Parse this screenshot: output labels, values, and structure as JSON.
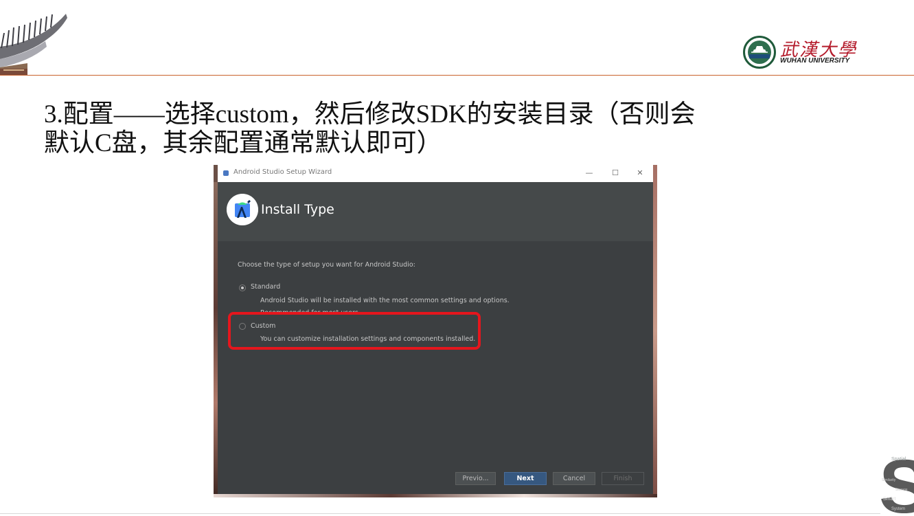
{
  "slide": {
    "title_line1": "3.配置——选择custom，然后修改SDK的安装目录（否则会",
    "title_line2": "默认C盘，其余配置通常默认即可）"
  },
  "logo": {
    "name_cn": "武漢大學",
    "name_en": "WUHAN UNIVERSITY"
  },
  "corner_logo": {
    "letter": "S",
    "words": [
      "Spatial",
      "Similarity",
      "Storage",
      "Smart",
      "System"
    ]
  },
  "window": {
    "title": "Android Studio Setup Wizard",
    "controls": {
      "minimize": "—",
      "maximize": "☐",
      "close": "✕"
    },
    "header_title": "Install Type",
    "prompt": "Choose the type of setup you want for Android Studio:",
    "options": [
      {
        "label": "Standard",
        "desc": "Android Studio will be installed with the most common settings and options.",
        "desc2": "Recommended for most users.",
        "selected": true
      },
      {
        "label": "Custom",
        "desc": "You can customize installation settings and components installed.",
        "selected": false
      }
    ],
    "buttons": {
      "previous": "Previo...",
      "next": "Next",
      "cancel": "Cancel",
      "finish": "Finish"
    }
  },
  "colors": {
    "highlight": "#e5161d",
    "accent": "#365880",
    "header_rule": "#c8622b",
    "logo_red": "#b41c2c"
  }
}
